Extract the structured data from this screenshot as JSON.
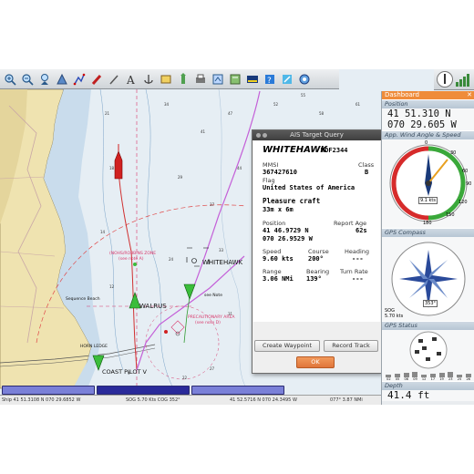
{
  "toolbar": {
    "tools": [
      "zoom-in-icon",
      "zoom-out-icon",
      "scale-in-icon",
      "scale-out-icon",
      "route-icon",
      "track-icon",
      "measure-icon",
      "text-icon",
      "anchor-icon",
      "ais-icon",
      "tide-icon",
      "print-icon",
      "settings-icon",
      "chart-book-icon",
      "dashboard-icon",
      "help-icon",
      "current-icon",
      "waypoint-icon"
    ]
  },
  "map": {
    "labels": {
      "walrus": "WALRUS",
      "whitehawk": "WHITEHAWK",
      "coast_pilot": "COAST PILOT V",
      "horn_ledge": "HORN LEDGE",
      "sequence_beach": "Sequence Beach",
      "red_zone_1": "(NOHS/ROBBINS ZONE",
      "red_zone_2": "(see note A)",
      "precautionary_1": "PRECAUTIONARY AREA",
      "precautionary_2": "(see note D)",
      "note": "see Note"
    }
  },
  "ais": {
    "window_title": "AIS Target Query",
    "name": "WHITEHAWK",
    "callsign": "WDF2344",
    "mmsi_label": "MMSI",
    "mmsi": "367427610",
    "class_label": "Class",
    "class_value": "B",
    "flag_label": "Flag",
    "flag": "United States of America",
    "vessel_type": "Pleasure craft",
    "dimensions": "33m x 6m",
    "position_label": "Position",
    "report_age_label": "Report Age",
    "lat": "41 46.9729 N",
    "report_age": "62s",
    "lon": "070 26.9529 W",
    "speed_label": "Speed",
    "course_label": "Course",
    "heading_label": "Heading",
    "speed": "9.60 kts",
    "course": "200°",
    "heading": "---",
    "range_label": "Range",
    "bearing_label": "Bearing",
    "turn_rate_label": "Turn Rate",
    "range": "3.06 NMi",
    "bearing": "139°",
    "turn_rate": "---",
    "create_waypoint": "Create Waypoint",
    "record_track": "Record Track",
    "ok": "OK"
  },
  "dashboard": {
    "caption": "Dashboard",
    "position_title": "Position",
    "position_lat": "41 51.310 N",
    "position_lon": "070 29.605 W",
    "wind_title": "App. Wind Angle & Speed",
    "wind_speed": "9.1 kts",
    "wind_ticks": [
      "0",
      "30",
      "60",
      "90",
      "120",
      "150",
      "180"
    ],
    "compass_title": "GPS Compass",
    "compass_heading": "353°",
    "sog_label": "SOG",
    "sog_value": "5.70 kts",
    "gps_status_title": "GPS Status",
    "gps_sats": [
      "02",
      "05",
      "06",
      "09",
      "12",
      "17",
      "19",
      "23",
      "25",
      "26"
    ],
    "depth_title": "Depth",
    "depth_value": "41.4 ft",
    "colors": {
      "caption": "#ef8c3a",
      "wind_port": "#d62b2b",
      "wind_stbd": "#3aa83a",
      "needle": "#e8a020"
    }
  },
  "statusbar": {
    "ship": "Ship 41 51.3108 N   070 29.6852 W",
    "sog": "SOG 5.70 Kts  COG 352°",
    "cursor": "41 52.5716 N   070 24.3495 W",
    "range": "077°  3.87 NMi"
  }
}
